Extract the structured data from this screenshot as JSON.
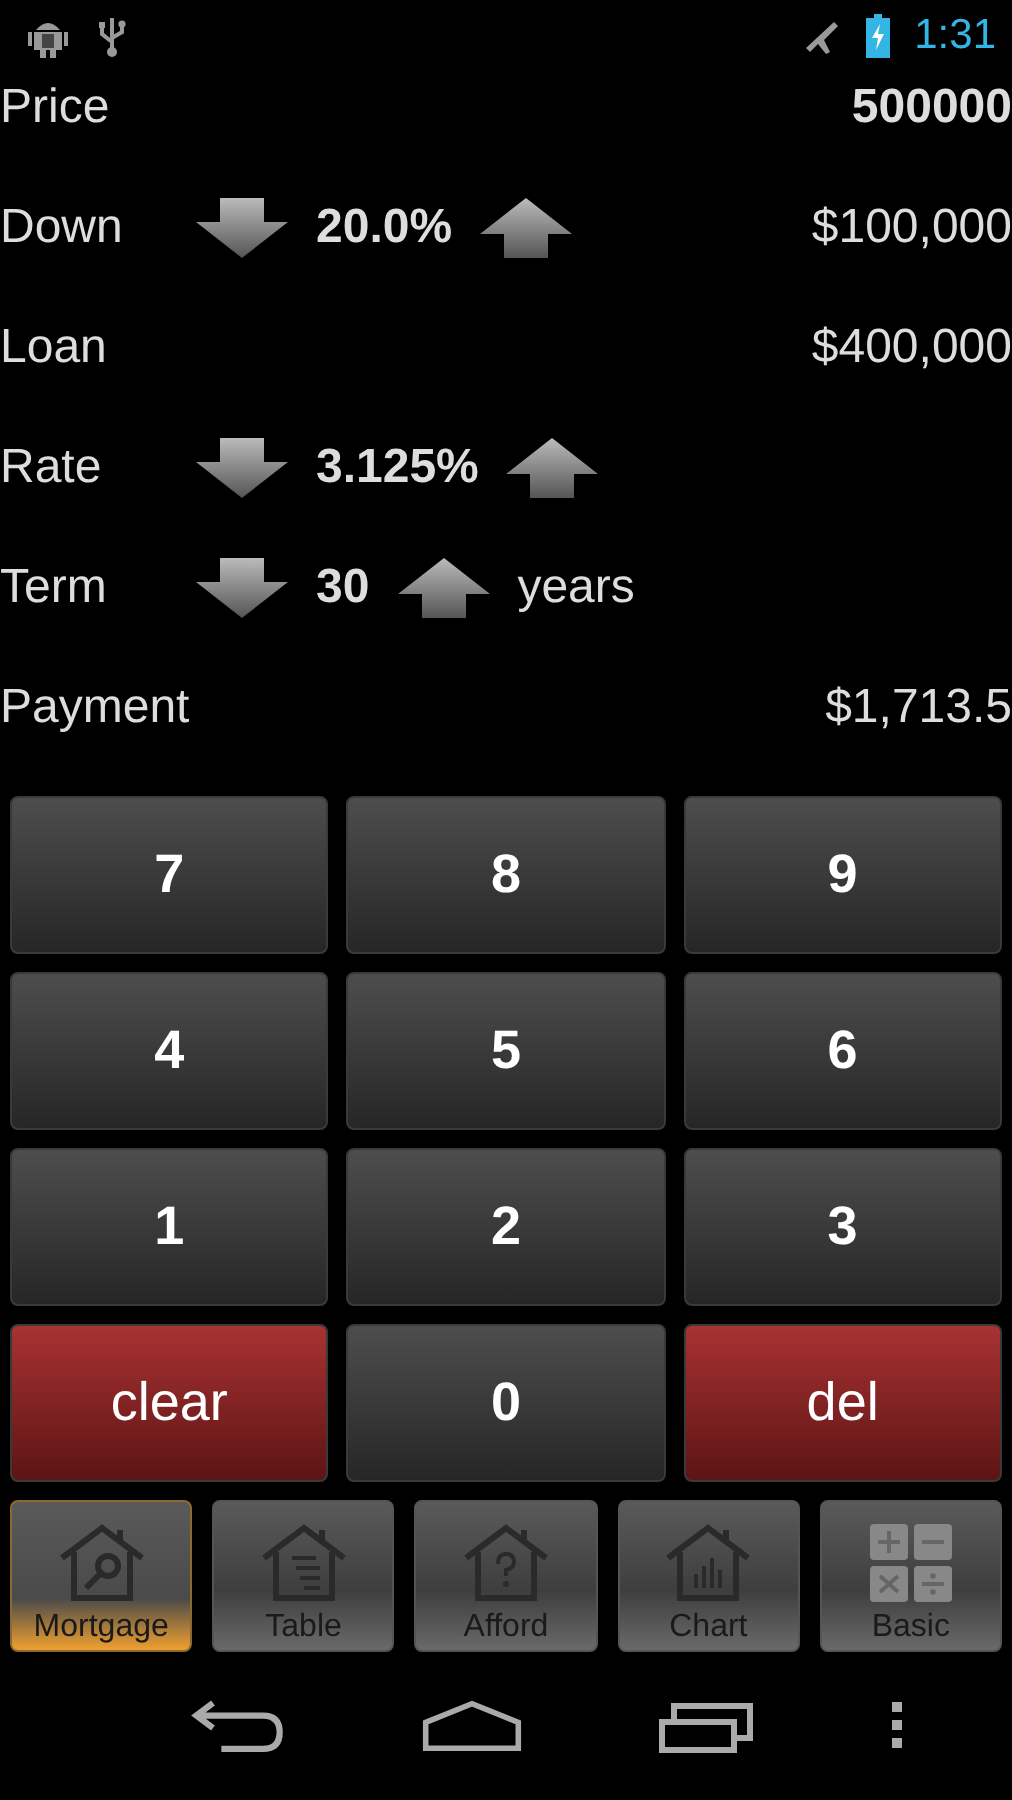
{
  "status_bar": {
    "time": "1:31"
  },
  "fields": [
    {
      "kind": "value",
      "label": "Price",
      "value": "500000",
      "bold": true
    },
    {
      "kind": "stepper",
      "label": "Down",
      "amount": "20.0%",
      "value": "$100,000"
    },
    {
      "kind": "value",
      "label": "Loan",
      "value": "$400,000",
      "bold": false
    },
    {
      "kind": "stepper",
      "label": "Rate",
      "amount": "3.125%"
    },
    {
      "kind": "stepper",
      "label": "Term",
      "amount": "30",
      "unit": "years"
    },
    {
      "kind": "value",
      "label": "Payment",
      "value": "$1,713.5",
      "bold": false
    }
  ],
  "keys": [
    {
      "label": "7",
      "kind": "digit"
    },
    {
      "label": "8",
      "kind": "digit"
    },
    {
      "label": "9",
      "kind": "digit"
    },
    {
      "label": "4",
      "kind": "digit"
    },
    {
      "label": "5",
      "kind": "digit"
    },
    {
      "label": "6",
      "kind": "digit"
    },
    {
      "label": "1",
      "kind": "digit"
    },
    {
      "label": "2",
      "kind": "digit"
    },
    {
      "label": "3",
      "kind": "digit"
    },
    {
      "label": "clear",
      "kind": "action"
    },
    {
      "label": "0",
      "kind": "digit"
    },
    {
      "label": "del",
      "kind": "action"
    }
  ],
  "tabs": [
    {
      "label": "Mortgage",
      "selected": true,
      "kind": "search"
    },
    {
      "label": "Table",
      "selected": false,
      "kind": "list"
    },
    {
      "label": "Afford",
      "selected": false,
      "kind": "question"
    },
    {
      "label": "Chart",
      "selected": false,
      "kind": "chart"
    },
    {
      "label": "Basic",
      "selected": false,
      "kind": "operators"
    }
  ]
}
